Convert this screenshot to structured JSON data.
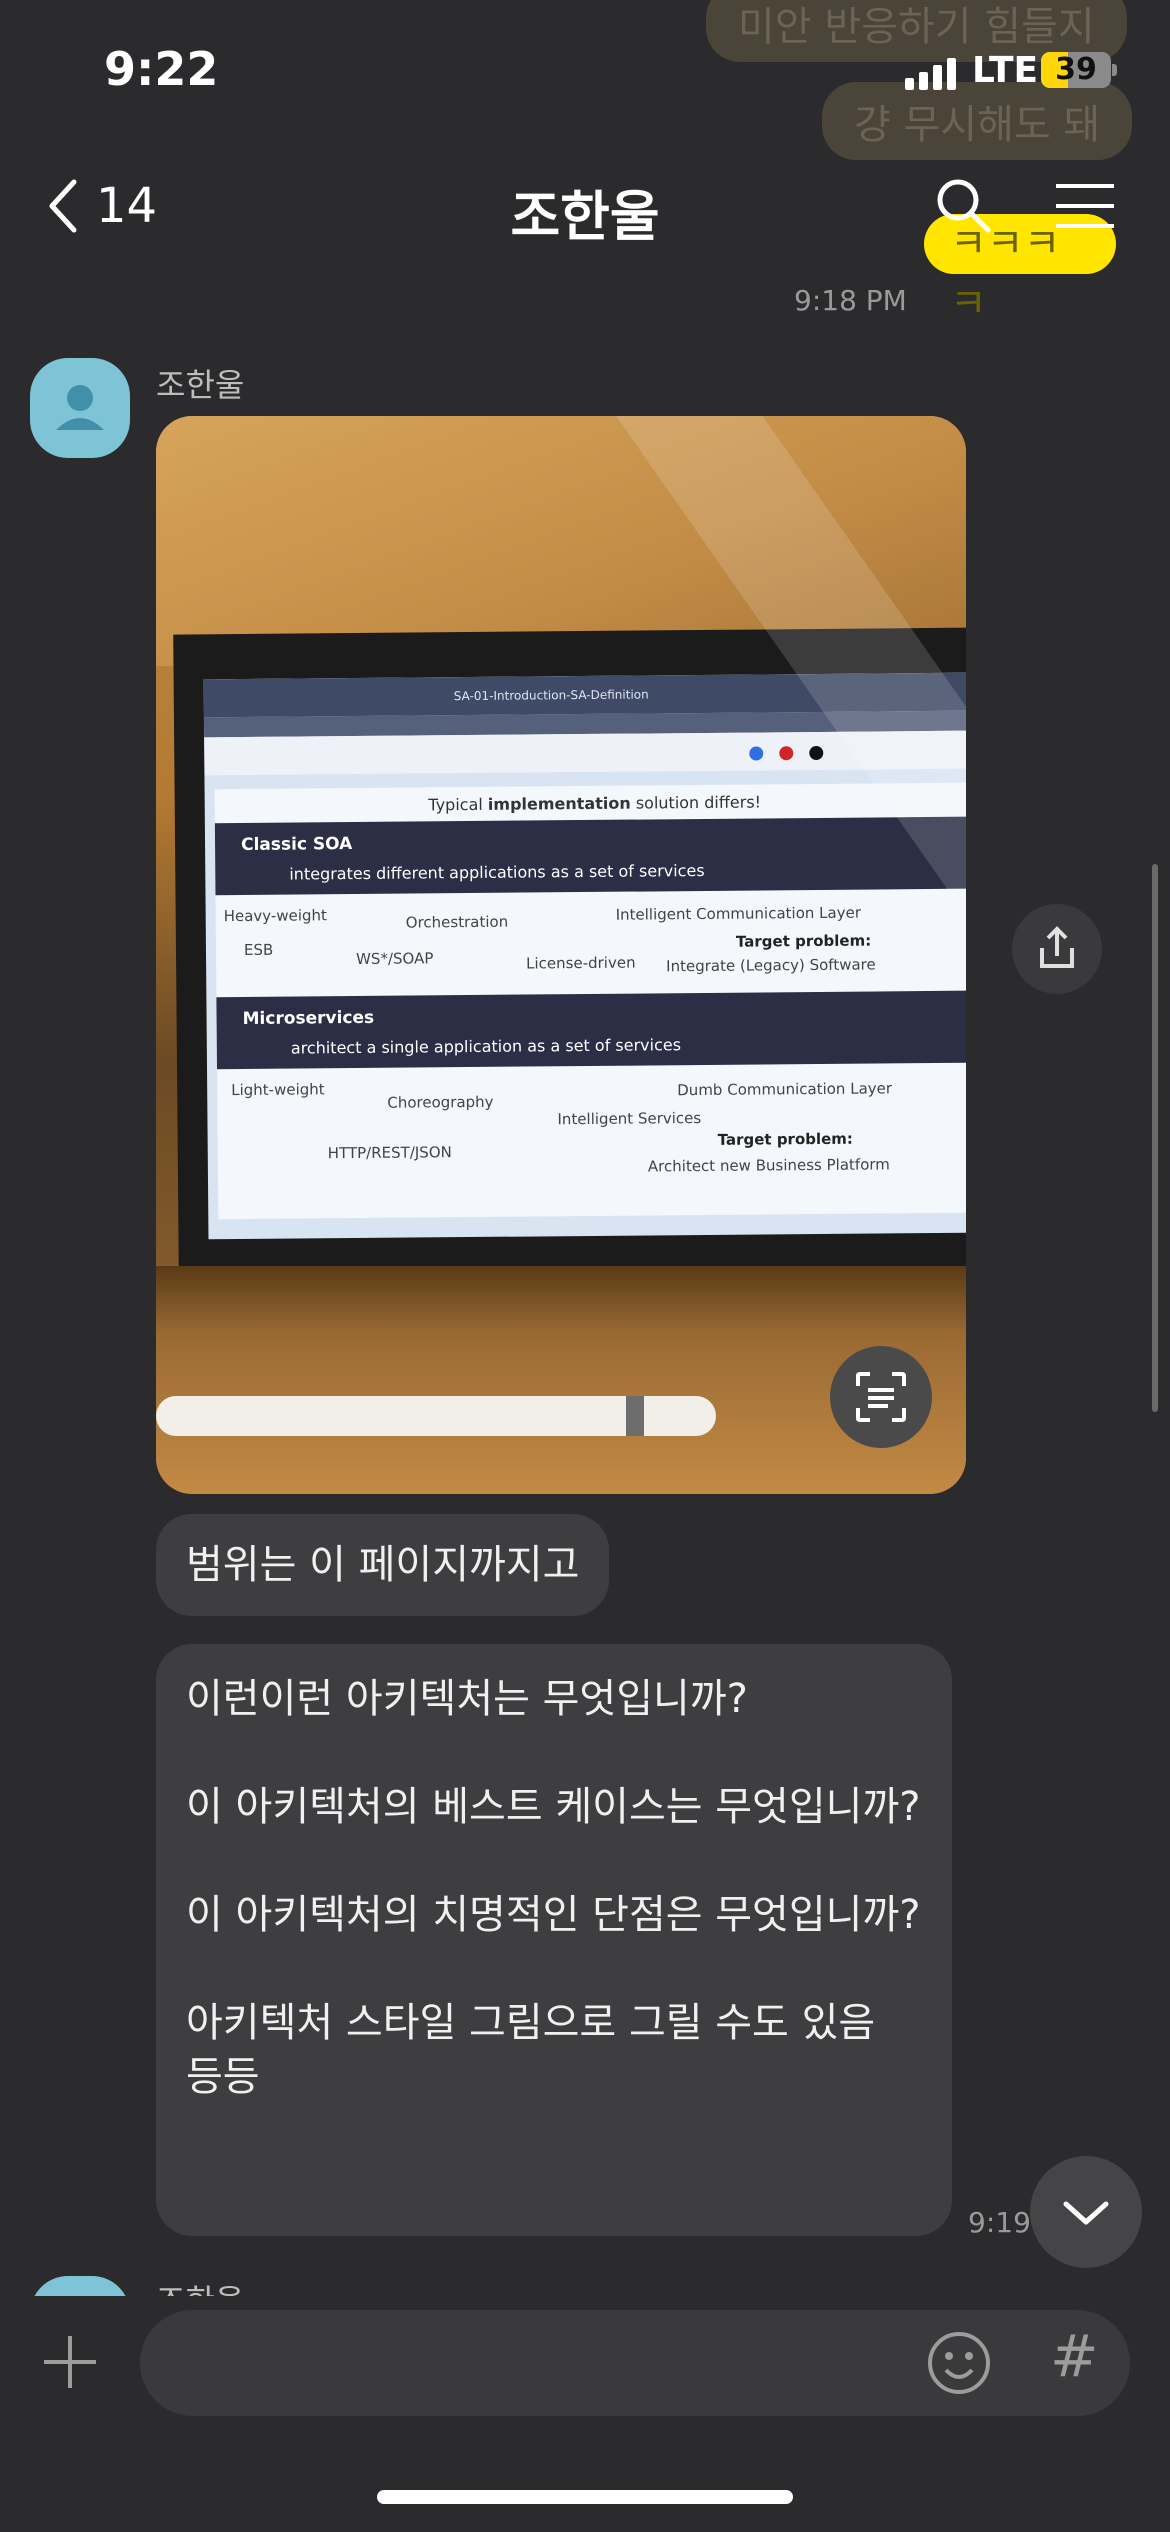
{
  "background_messages": {
    "line1": "미안 반응하기 힘들지",
    "line2": "걍 무시해도 돼",
    "line3": "ㅋㅋㅋㅋ",
    "time": "9:18 PM"
  },
  "status_bar": {
    "time": "9:22",
    "network": "LTE",
    "battery": "39",
    "battery_level": 0.39
  },
  "header": {
    "back_count": "14",
    "title": "조한울"
  },
  "message_group": {
    "sender": "조한울",
    "photo": {
      "slide_title_prefix": "Typical",
      "slide_title_bold": "implementation",
      "slide_title_suffix": "solution differs!",
      "tab_title": "SA-01-Introduction-SA-Definition",
      "section1_heading": "Classic SOA",
      "section1_sub": "integrates different applications as a set of services",
      "section1_keywords": [
        "Heavy-weight",
        "Orchestration",
        "Intelligent Communication Layer",
        "ESB",
        "WS*/SOAP",
        "License-driven"
      ],
      "section1_target_label": "Target problem:",
      "section1_target": "Integrate (Legacy) Software",
      "section2_heading": "Microservices",
      "section2_sub": "architect a single application as a set of services",
      "section2_keywords": [
        "Light-weight",
        "Choreography",
        "Intelligent Services",
        "Dumb Communication Layer",
        "HTTP/REST/JSON"
      ],
      "section2_target_label": "Target problem:",
      "section2_target": "Architect new Business Platform"
    },
    "bubble1": "범위는 이 페이지까지고",
    "bubble2": {
      "para1": "이런이런 아키텍처는 무엇입니까?",
      "para2": "이 아키텍처의 베스트 케이스는 무엇입니까?",
      "para3": "이 아키텍처의 치명적인 단점은 무엇입니까?",
      "para4": "아키텍처 스타일 그림으로 그릴 수도 있음 등등"
    },
    "time": "9:19 PM"
  },
  "next_sender": "조한울",
  "input": {
    "placeholder": "",
    "value": "",
    "hash": "#"
  }
}
